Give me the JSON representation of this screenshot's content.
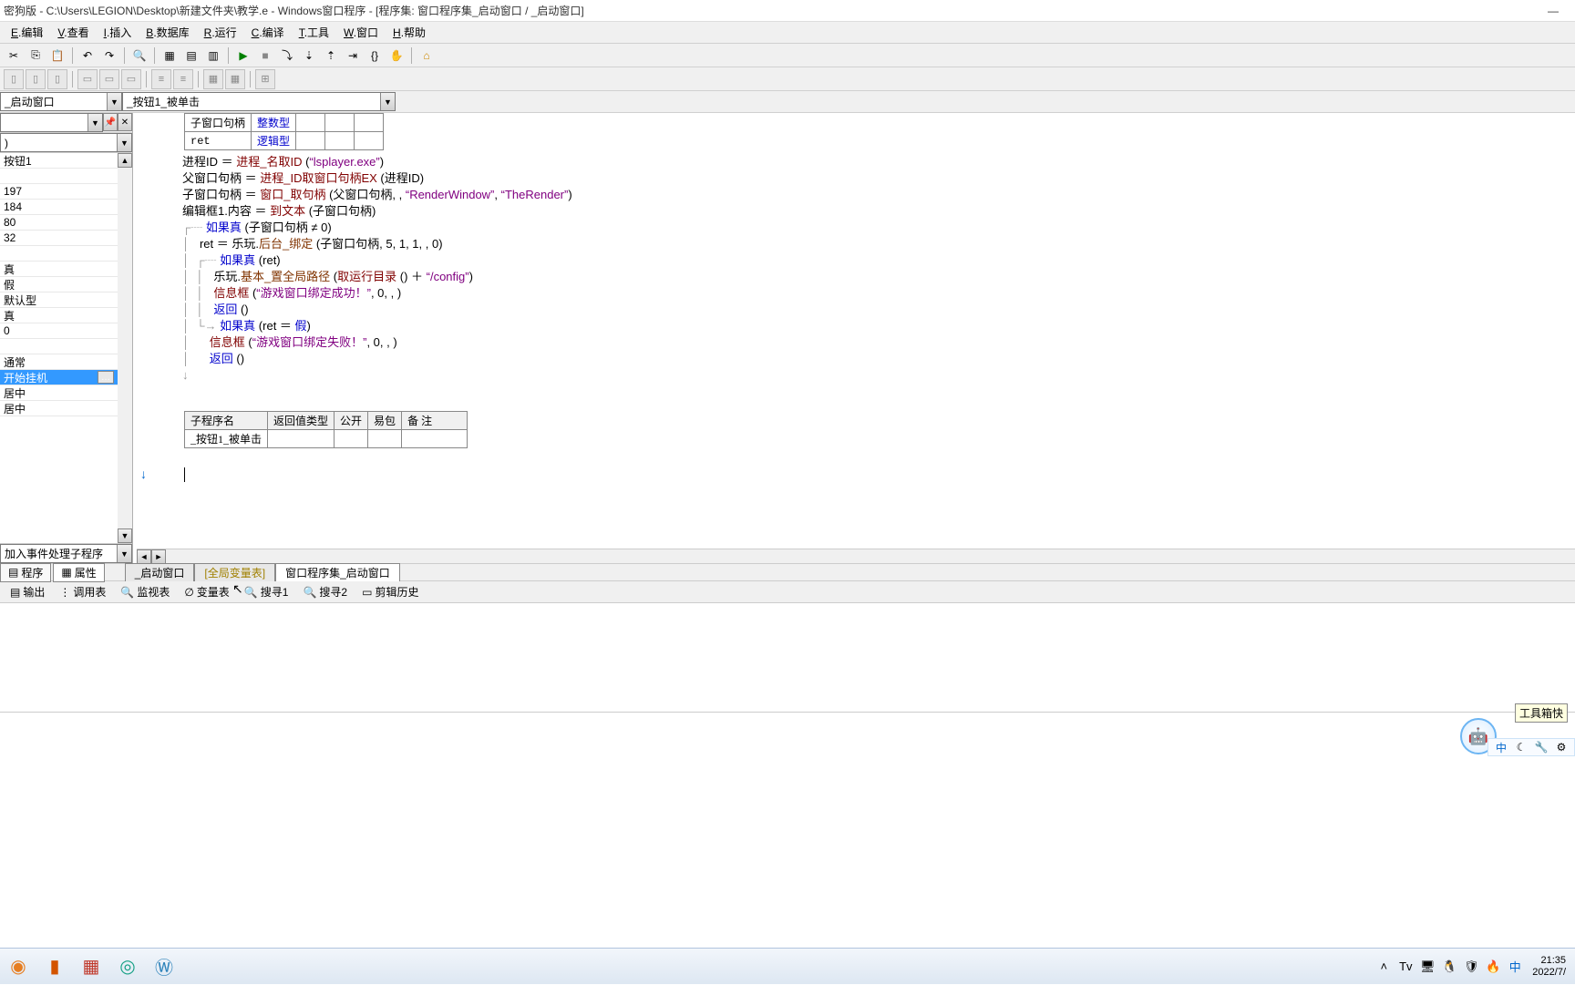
{
  "title": "密狗版 - C:\\Users\\LEGION\\Desktop\\新建文件夹\\教学.e - Windows窗口程序 - [程序集: 窗口程序集_启动窗口 / _启动窗口]",
  "menu": {
    "edit": {
      "u": "E",
      "t": ".编辑"
    },
    "view": {
      "u": "V",
      "t": ".查看"
    },
    "insert": {
      "u": "I",
      "t": ".插入"
    },
    "db": {
      "u": "B",
      "t": ".数据库"
    },
    "run": {
      "u": "R",
      "t": ".运行"
    },
    "compile": {
      "u": "C",
      "t": ".编译"
    },
    "tools": {
      "u": "T",
      "t": ".工具"
    },
    "window": {
      "u": "W",
      "t": ".窗口"
    },
    "help": {
      "u": "H",
      "t": ".帮助"
    }
  },
  "combo1": "_启动窗口",
  "combo2": "_按钮1_被单击",
  "left": {
    "combo_small": ")",
    "items": [
      "按钮1",
      "",
      "197",
      "184",
      "80",
      "32",
      "",
      "真",
      "假",
      "默认型",
      "真",
      "0",
      "",
      "通常"
    ],
    "selected": "开始挂机",
    "after": [
      "居中",
      "居中"
    ],
    "footer_combo": "加入事件处理子程序"
  },
  "vars": {
    "r1c1": "子窗口句柄",
    "r1c2": "整数型",
    "r2c1": "ret",
    "r2c2": "逻辑型"
  },
  "code": {
    "l1a": "进程ID ＝ ",
    "l1b": "进程_名取ID",
    "l1c": " (",
    "l1d": "“lsplayer.exe”",
    "l1e": ")",
    "l2a": "父窗口句柄 ＝ ",
    "l2b": "进程_ID取窗口句柄EX",
    "l2c": " (进程ID)",
    "l3a": "子窗口句柄 ＝ ",
    "l3b": "窗口_取句柄",
    "l3c": " (父窗口句柄, , ",
    "l3d": "“RenderWindow”",
    "l3e": ", ",
    "l3f": "“TheRender”",
    "l3g": ")",
    "l4a": "编辑框1.内容 ＝ ",
    "l4b": "到文本",
    "l4c": " (子窗口句柄)",
    "l5a": "如果真",
    "l5b": " (子窗口句柄 ≠ 0)",
    "l6a": "ret ＝ 乐玩.",
    "l6b": "后台_绑定",
    "l6c": " (子窗口句柄, 5, 1, 1, , 0)",
    "l7a": "如果真",
    "l7b": " (ret)",
    "l8a": "乐玩.",
    "l8b": "基本_置全局路径",
    "l8c": " (",
    "l8d": "取运行目录",
    "l8e": " () ＋ ",
    "l8f": "“/config”",
    "l8g": ")",
    "l9a": "信息框",
    "l9b": " (",
    "l9c": "“游戏窗口绑定成功！”",
    "l9d": ", 0, , )",
    "l10a": "返回",
    "l10b": " ()",
    "l11a": "如果真",
    "l11b": " (ret ＝ ",
    "l11c": "假",
    "l11d": ")",
    "l12a": "信息框",
    "l12b": " (",
    "l12c": "“游戏窗口绑定失败！”",
    "l12d": ", 0, , )",
    "l13a": "返回",
    "l13b": " ()"
  },
  "subproc": {
    "h1": "子程序名",
    "h2": "返回值类型",
    "h3": "公开",
    "h4": "易包",
    "h5": "备 注",
    "r1": "_按钮1_被单击"
  },
  "side_tabs": {
    "prog": "程序",
    "prop": "属性"
  },
  "doc_tabs": {
    "t1": "_启动窗口",
    "t2": "[全局变量表]",
    "t3": "窗口程序集_启动窗口"
  },
  "info_tabs": {
    "t1": "输出",
    "t2": "调用表",
    "t3": "监视表",
    "t4": "变量表",
    "t5": "搜寻1",
    "t6": "搜寻2",
    "t7": "剪辑历史"
  },
  "tool_hint": "工具箱快",
  "status": {
    "ime": "中"
  },
  "clock": {
    "time": "21:35",
    "date": "2022/7/"
  }
}
